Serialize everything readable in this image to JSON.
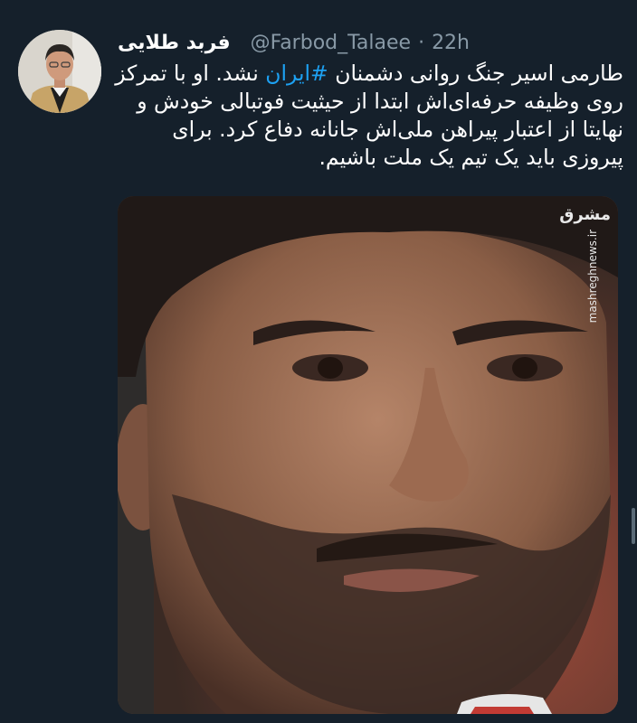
{
  "tweet": {
    "display_name": "فربد طلایی",
    "handle": "@Farbod_Talaee",
    "dot": "·",
    "time": "22h",
    "text_line1_before": "طارمی اسیر جنگ روانی دشمنان ",
    "hashtag": "#ایران",
    "text_line1_after": " نشد. او با تمرکز",
    "text_line2": "روی وظیفه حرفه‌ای‌اش ابتدا از حیثیت فوتبالی خودش و",
    "text_line3": "نهایتا از اعتبار پیراهن ملی‌اش جانانه دفاع کرد. برای",
    "text_line4": "پیروزی باید یک تیم یک ملت باشیم."
  },
  "watermark": {
    "logo": "مشرق",
    "url": "mashreghnews.ir"
  },
  "colors": {
    "background": "#15202b",
    "secondary_text": "#8899a6",
    "hashtag": "#1da1f2"
  },
  "icons": {
    "avatar": "profile-photo",
    "media": "player-face-photo"
  }
}
